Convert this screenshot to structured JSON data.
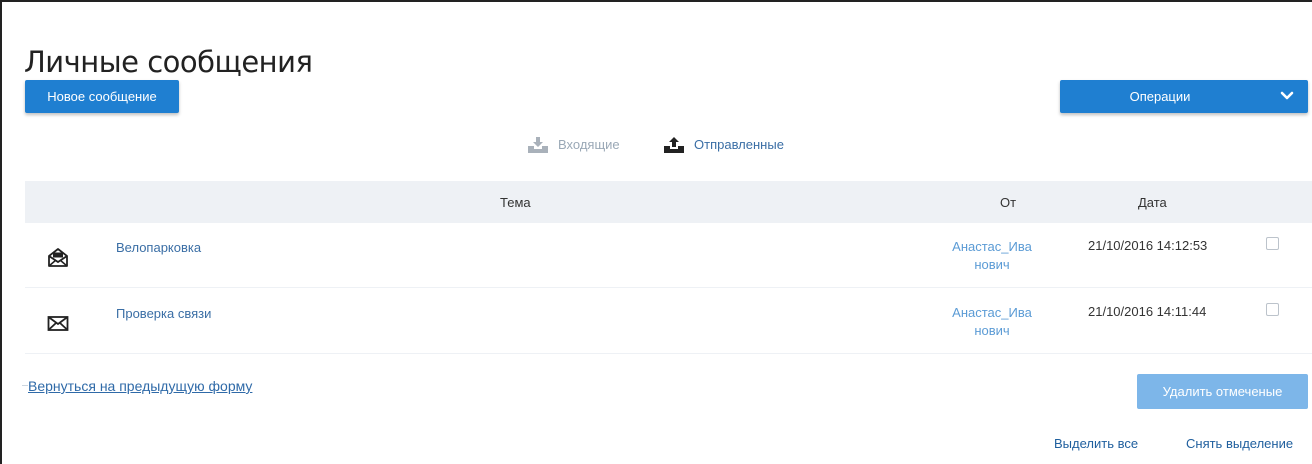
{
  "page": {
    "title": "Личные сообщения"
  },
  "toolbar": {
    "new_message_label": "Новое сообщение",
    "operations_label": "Операции"
  },
  "tabs": [
    {
      "label": "Входящие",
      "icon": "inbox-tray-icon",
      "active": false
    },
    {
      "label": "Отправленные",
      "icon": "outbox-tray-icon",
      "active": true
    }
  ],
  "table": {
    "columns": {
      "topic": "Тема",
      "from": "От",
      "date": "Дата"
    },
    "rows": [
      {
        "icon": "envelope-open-icon",
        "subject": "Велопарковка",
        "from": "Анастас_Иванович",
        "date": "21/10/2016 14:12:53",
        "checked": false
      },
      {
        "icon": "envelope-icon",
        "subject": "Проверка связи",
        "from": "Анастас_Иванович",
        "date": "21/10/2016 14:11:44",
        "checked": false
      }
    ]
  },
  "footer": {
    "back_label": "Вернуться на предыдущую форму",
    "delete_label": "Удалить отмеченые",
    "select_all_label": "Выделить все",
    "unselect_label": "Снять выделение"
  },
  "colors": {
    "primary": "#1f7fd1",
    "primary_disabled": "#7db6e9",
    "link": "#3a6ea5",
    "header_bg": "#eef1f5"
  }
}
